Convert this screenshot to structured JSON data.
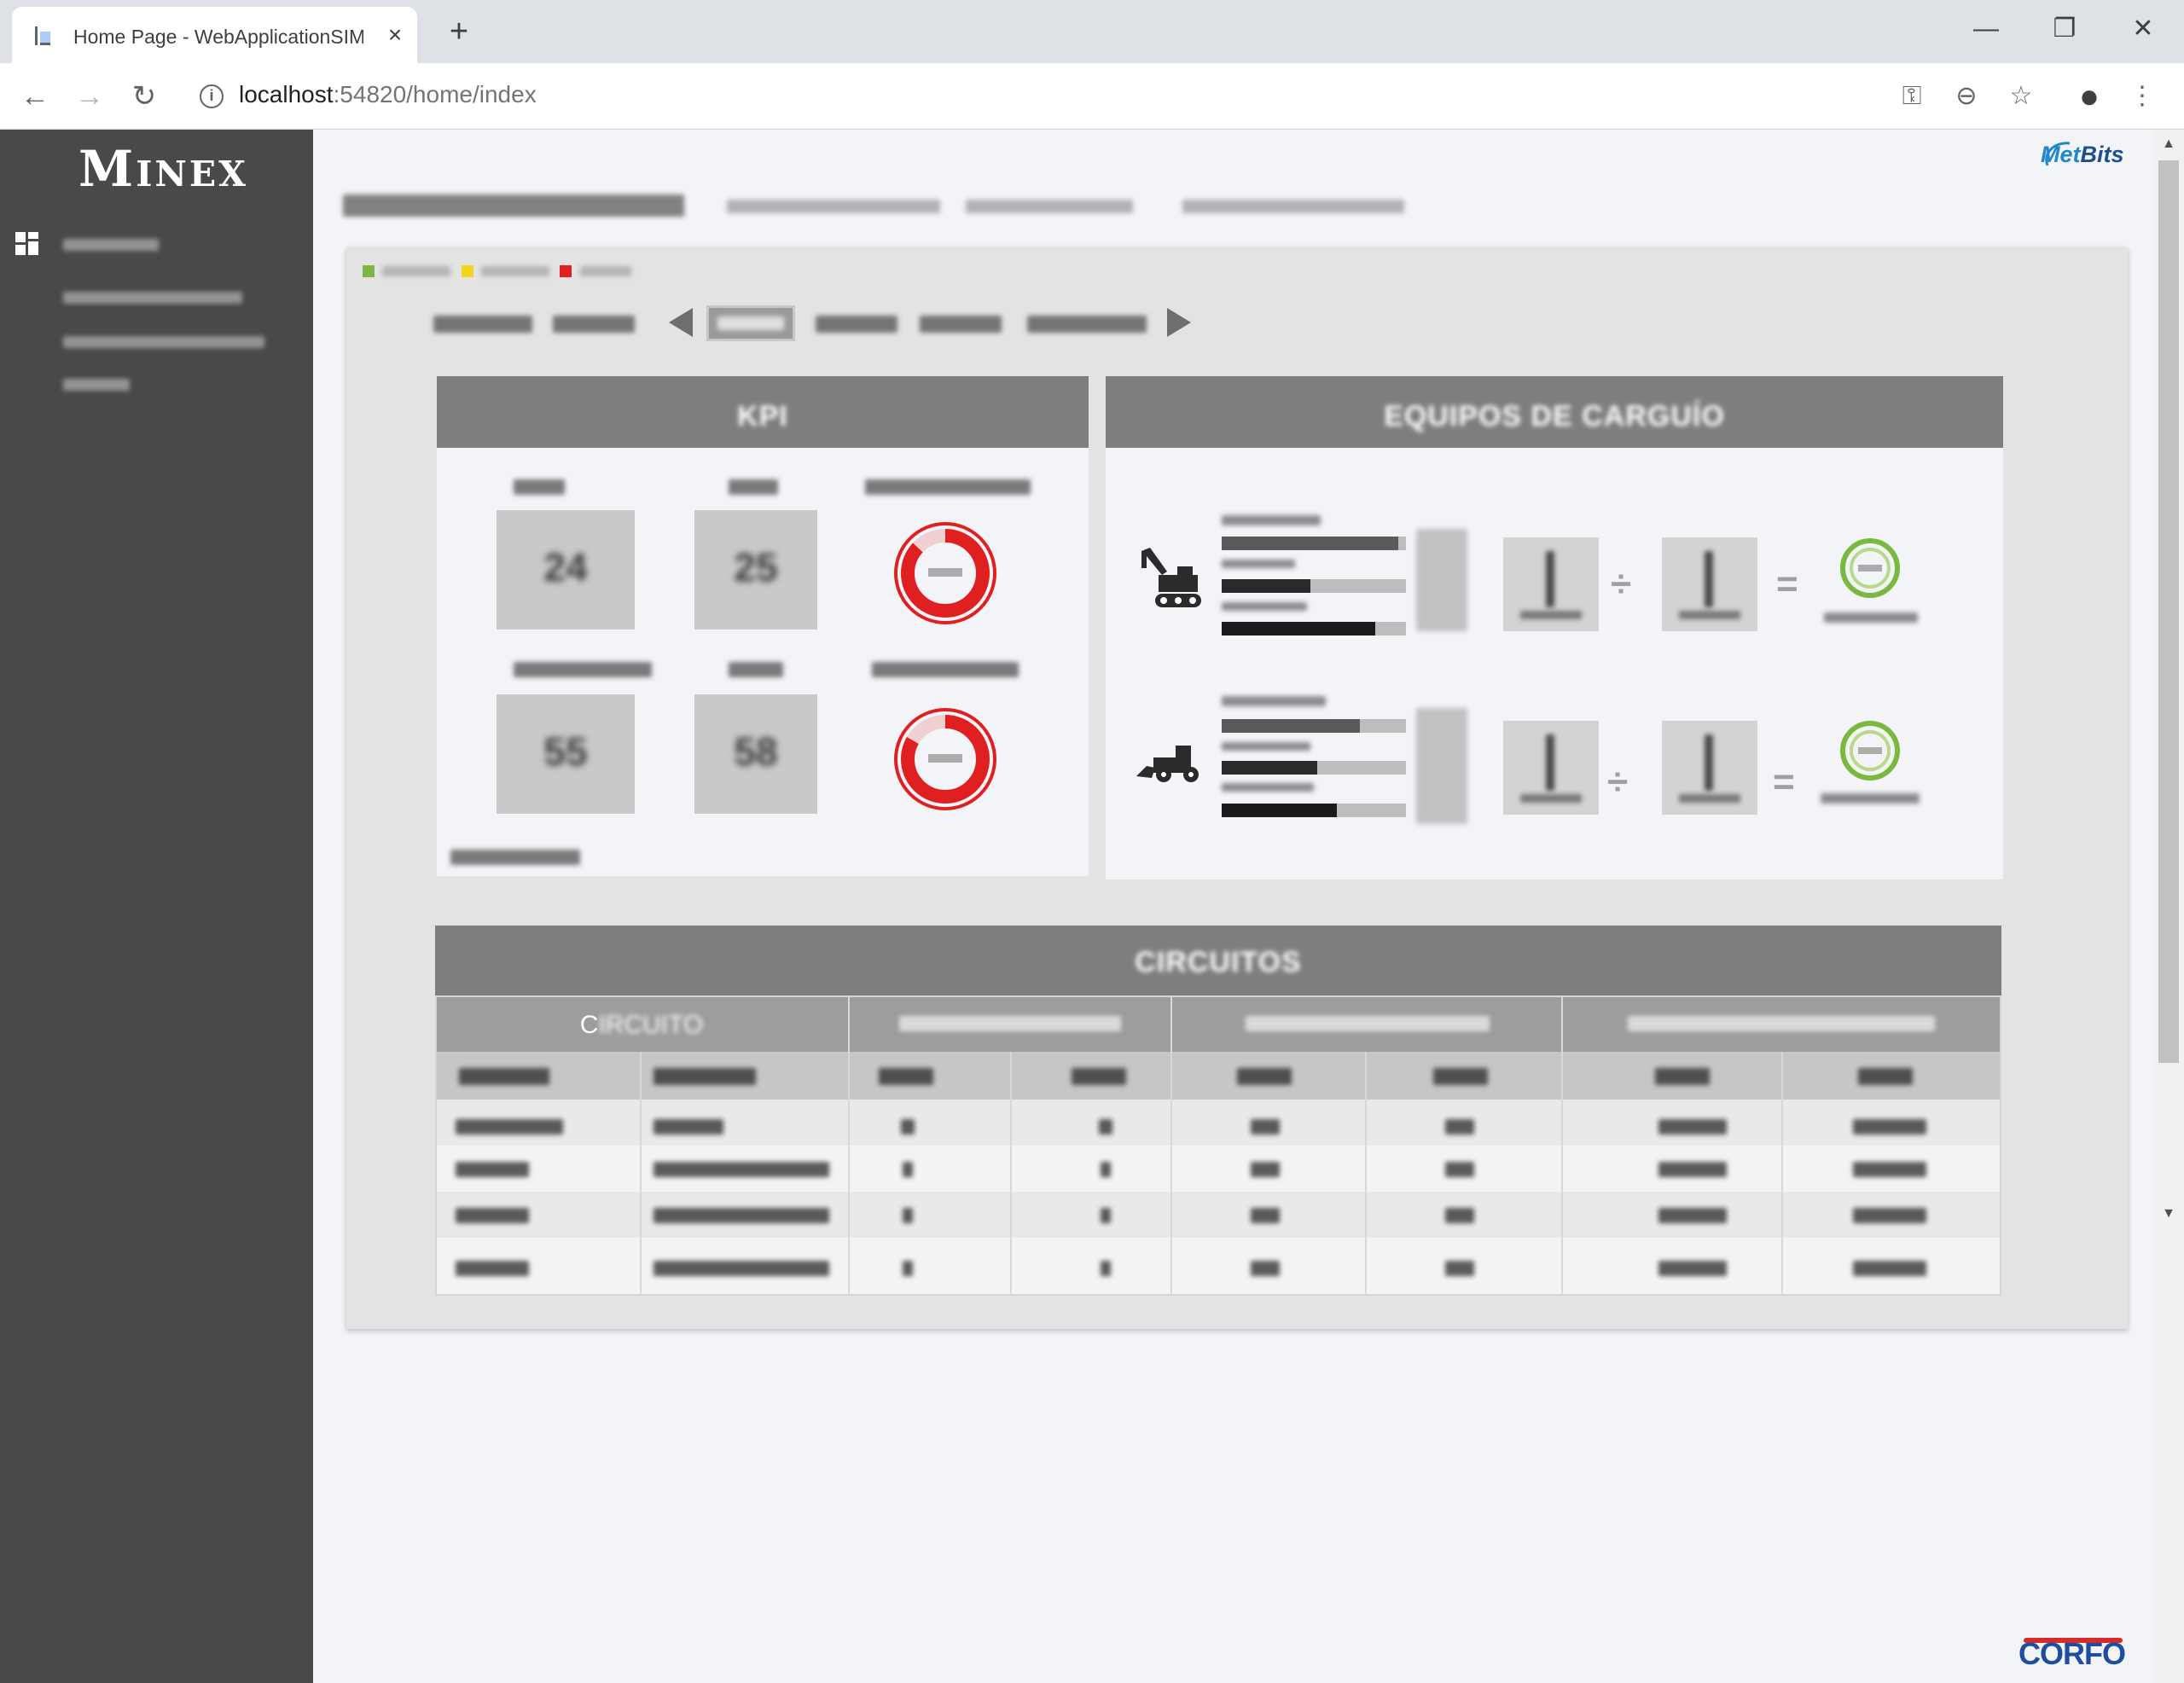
{
  "browser": {
    "tab_title": "Home Page - WebApplicationSIM",
    "tab_close": "×",
    "new_tab": "+",
    "url_host": "localhost",
    "url_rest": ":54820/home/index",
    "window_controls": {
      "minimize": "—",
      "restore": "❐",
      "close": "✕"
    },
    "nav": {
      "back": "←",
      "forward": "→",
      "reload": "↻"
    },
    "toolbar_icons": {
      "key": "⚿",
      "zoom": "⊖",
      "bookmark": "☆",
      "profile": "●",
      "menu": "⋮"
    },
    "info": "i"
  },
  "sidebar": {
    "logo": "Minex"
  },
  "brands": {
    "metbits_prefix": "Met",
    "metbits_suffix": "Bits",
    "corfo": "CORFO"
  },
  "legend_colors": {
    "green": "#7ab83f",
    "yellow": "#f2d51c",
    "red": "#e02020"
  },
  "kpi": {
    "title": "KPI",
    "values": [
      "24",
      "25",
      "55",
      "58"
    ]
  },
  "equipos": {
    "title": "EQUIPOS DE CARGUÍO",
    "divide": "÷",
    "equals": "="
  },
  "circuitos": {
    "title": "CIRCUITOS",
    "col_circuito_first": "C",
    "col_circuito_rest": "IRCUITO"
  },
  "colors": {
    "header_gray": "#7e7e7e",
    "donut_red": "#e02020",
    "donut_green": "#7ab83f"
  }
}
